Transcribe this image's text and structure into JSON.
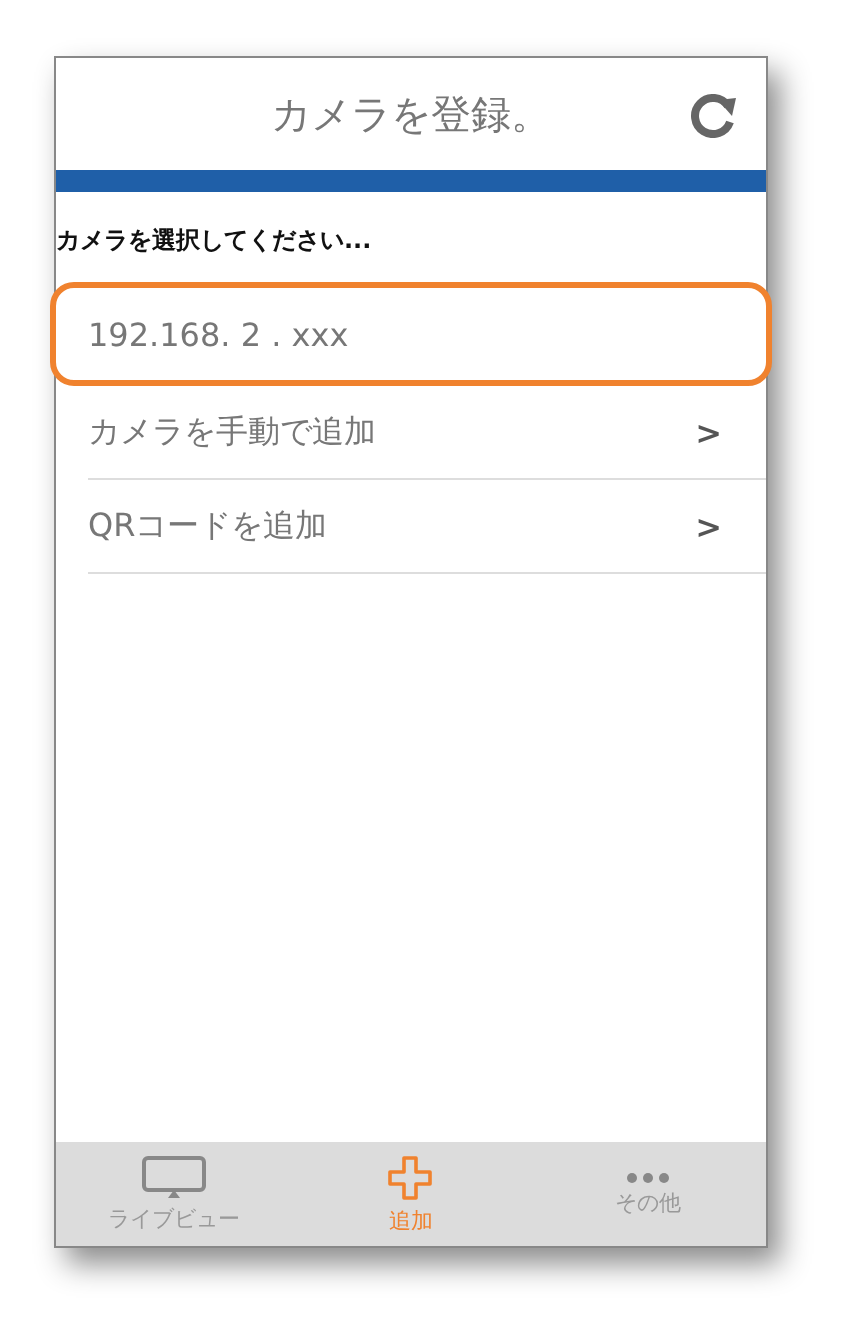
{
  "header": {
    "title": "カメラを登録。"
  },
  "prompt": "カメラを選択してください...",
  "items": [
    {
      "kind": "camera",
      "label": "192.168.  2  .  xxx",
      "highlighted": true
    },
    {
      "kind": "link",
      "label": "カメラを手動で追加",
      "chevron": ">",
      "highlighted": false
    },
    {
      "kind": "link",
      "label": "QRコードを追加",
      "chevron": ">",
      "highlighted": false
    }
  ],
  "tabs": [
    {
      "kind": "monitor",
      "label": "ライブビュー",
      "selected": false
    },
    {
      "kind": "plus",
      "label": "追加",
      "selected": true
    },
    {
      "kind": "more",
      "label": "その他",
      "selected": false
    }
  ]
}
